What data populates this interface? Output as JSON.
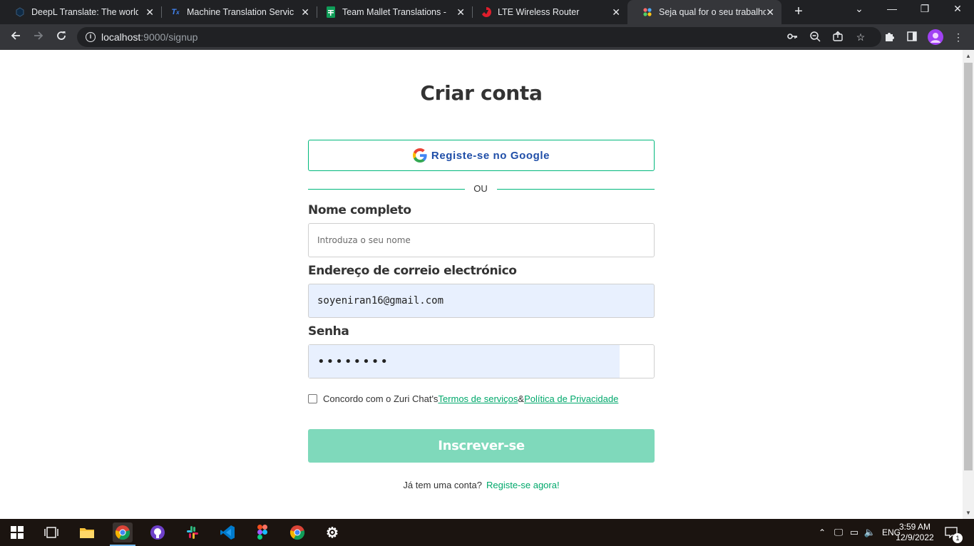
{
  "browser": {
    "tabs": [
      {
        "title": "DeepL Translate: The world's",
        "favicon": "deepl-icon",
        "color": "#0f2b46"
      },
      {
        "title": "Machine Translation Service |",
        "favicon": "translate-icon",
        "color": "#4285f4"
      },
      {
        "title": "Team Mallet Translations - Go",
        "favicon": "sheets-icon",
        "color": "#0f9d58"
      },
      {
        "title": "LTE Wireless Router",
        "favicon": "router-icon",
        "color": "#e01e2c"
      },
      {
        "title": "Seja qual for o seu trabalho, f",
        "favicon": "zuri-icon",
        "color": "#ff6b6b"
      }
    ],
    "active_tab": 4,
    "url_host": "localhost",
    "url_rest": ":9000/signup"
  },
  "page": {
    "title": "Criar conta",
    "google_button": "Registe-se no Google",
    "or_text": "OU",
    "name_label": "Nome completo",
    "name_placeholder": "Introduza o seu nome",
    "email_label": "Endereço de correio electrónico",
    "email_value": "soyeniran16@gmail.com",
    "password_label": "Senha",
    "password_value": "••••••••",
    "terms_prefix": "Concordo com o Zuri Chat's",
    "terms_link": "Termos de serviços ",
    "terms_amp": "&",
    "privacy_link": " Política de Privacidade",
    "submit_label": "Inscrever-se",
    "have_account": "Já tem uma conta?",
    "register_link": "Registe-se agora!"
  },
  "colors": {
    "brand_green": "#00b87c",
    "submit_disabled": "#7fd9bb",
    "link_green": "#00a86b",
    "google_text": "#1f4ea8",
    "autofill_bg": "#e8f0fe"
  },
  "taskbar": {
    "apps": [
      "windows-start-icon",
      "task-view-icon",
      "file-explorer-icon",
      "chrome-icon",
      "github-desktop-icon",
      "slack-icon",
      "vscode-icon",
      "figma-icon",
      "chrome-icon",
      "settings-icon"
    ],
    "language": "ENG",
    "time": "3:59 AM",
    "date": "12/9/2022",
    "notification_count": "1"
  }
}
